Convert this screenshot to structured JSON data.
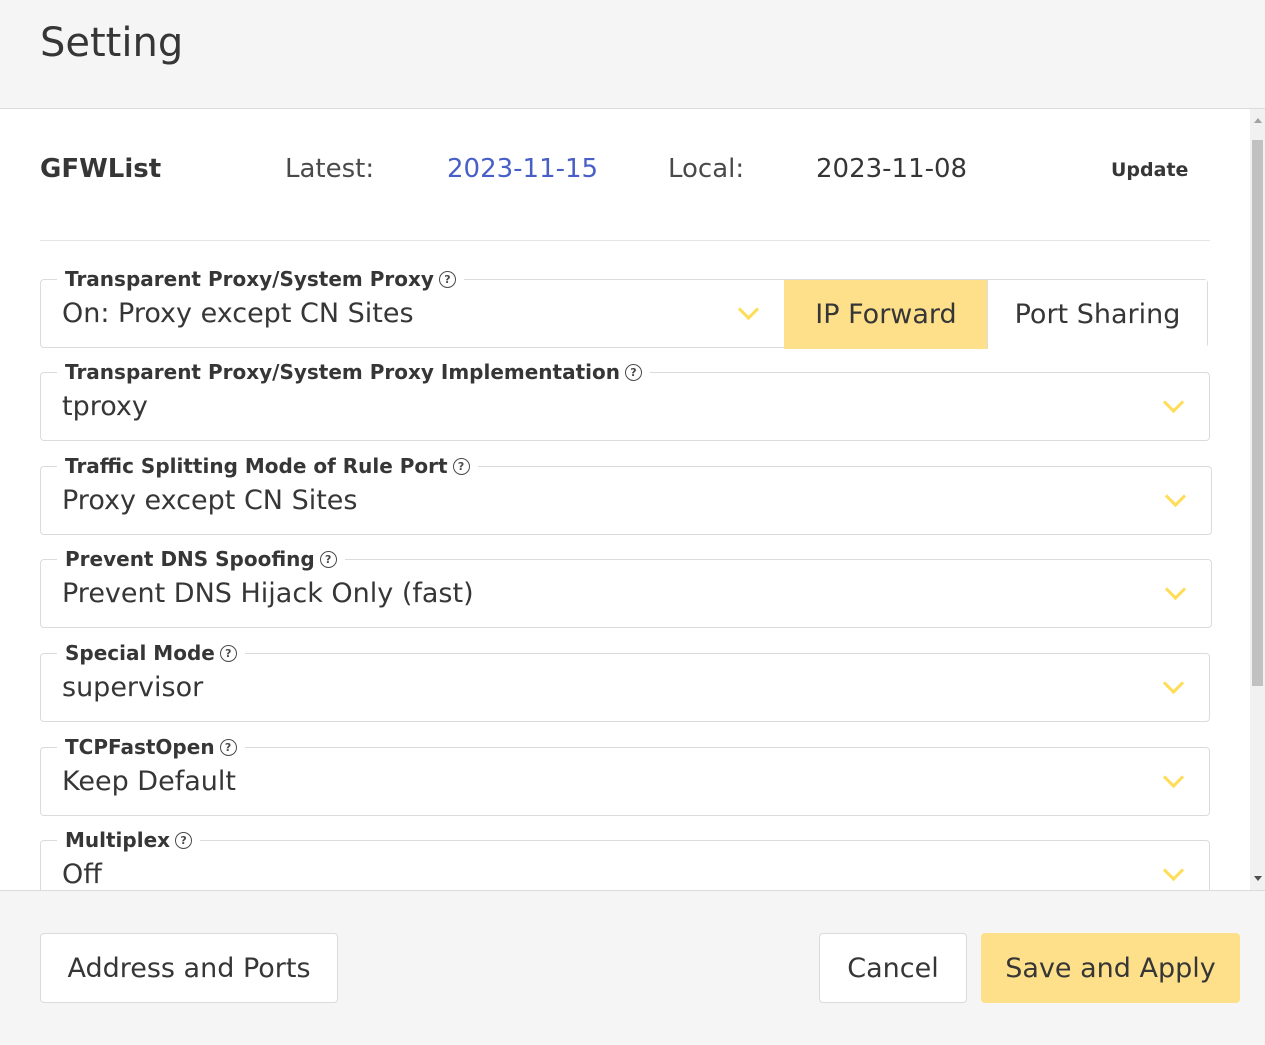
{
  "header": {
    "title": "Setting"
  },
  "gfwlist": {
    "name": "GFWList",
    "latest_label": "Latest:",
    "latest_value": "2023-11-15",
    "local_label": "Local:",
    "local_value": "2023-11-08",
    "update_label": "Update"
  },
  "fields": [
    {
      "label": "Transparent Proxy/System Proxy",
      "value": "On: Proxy except CN Sites",
      "segments": [
        "IP Forward",
        "Port Sharing"
      ],
      "active_segment": "IP Forward"
    },
    {
      "label": "Transparent Proxy/System Proxy Implementation",
      "value": "tproxy"
    },
    {
      "label": "Traffic Splitting Mode of Rule Port",
      "value": "Proxy except CN Sites"
    },
    {
      "label": "Prevent DNS Spoofing",
      "value": "Prevent DNS Hijack Only (fast)"
    },
    {
      "label": "Special Mode",
      "value": "supervisor"
    },
    {
      "label": "TCPFastOpen",
      "value": "Keep Default"
    },
    {
      "label": "Multiplex",
      "value": "Off"
    }
  ],
  "footer": {
    "address_ports_label": "Address and Ports",
    "cancel_label": "Cancel",
    "save_apply_label": "Save and Apply"
  },
  "icons": {
    "help": "question-circle-icon",
    "dropdown": "chevron-down-icon"
  },
  "colors": {
    "accent": "#ffe08a",
    "chevron": "#ffdd57",
    "link": "#485fc7"
  }
}
